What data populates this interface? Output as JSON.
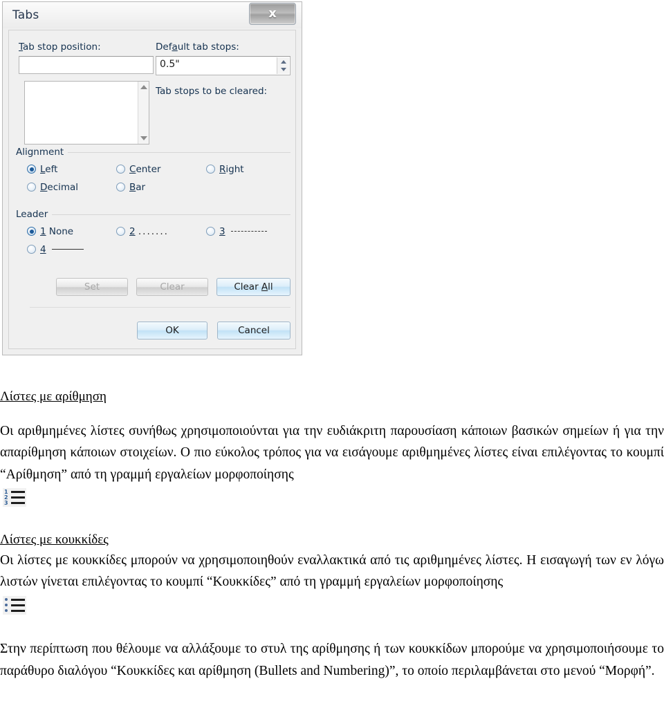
{
  "dialog": {
    "title": "Tabs",
    "close_label": "x",
    "tab_stop_position": {
      "label_pre": "T",
      "label_post": "ab stop position:",
      "value": ""
    },
    "default_tab_stops": {
      "label_pre": "Def",
      "label_mid": "a",
      "label_post": "ult tab stops:",
      "value": "0.5\""
    },
    "tab_stops_to_be_cleared_label": "Tab stops to be cleared:",
    "alignment": {
      "caption": "Alignment",
      "options": [
        {
          "key": "left",
          "accel": "L",
          "rest": "eft",
          "selected": true
        },
        {
          "key": "center",
          "accel": "C",
          "rest": "enter",
          "selected": false
        },
        {
          "key": "right",
          "accel": "R",
          "rest": "ight",
          "selected": false
        },
        {
          "key": "decimal",
          "accel": "D",
          "rest": "ecimal",
          "selected": false
        },
        {
          "key": "bar",
          "accel": "B",
          "rest": "ar",
          "selected": false
        }
      ]
    },
    "leader": {
      "caption": "Leader",
      "options": [
        {
          "key": "none",
          "num": "1",
          "rest": " None",
          "sample": "",
          "selected": true
        },
        {
          "key": "dots",
          "num": "2",
          "rest": " ",
          "sample": ".......",
          "selected": false
        },
        {
          "key": "dashes",
          "num": "3",
          "rest": " ",
          "sample": "-------",
          "selected": false
        },
        {
          "key": "solid",
          "num": "4",
          "rest": " ",
          "sample": "_____",
          "selected": false
        }
      ]
    },
    "buttons": {
      "set": "Set",
      "clear": "Clear",
      "clear_all_pre": "Clear ",
      "clear_all_accel": "A",
      "clear_all_post": "ll",
      "ok": "OK",
      "cancel": "Cancel"
    }
  },
  "document": {
    "heading_numbered": "Λίστες με αρίθμηση",
    "para_numbered": "Οι αριθμημένες λίστες συνήθως χρησιμοποιούνται για την ευδιάκριτη παρουσίαση κάποιων βασικών σημείων ή για την απαρίθμηση κάποιων στοιχείων. Ο πιο εύκολος τρόπος για να εισάγουμε αριθμημένες λίστες είναι επιλέγοντας το κουμπί “Αρίθμηση” από τη γραμμή εργαλείων μορφοποίησης",
    "numbered_icon_marks": [
      "1",
      "2",
      "3"
    ],
    "heading_bulleted": "Λίστες με κουκκίδες",
    "para_bulleted": "Οι λίστες  με κουκκίδες μπορούν να χρησιμοποιηθούν εναλλακτικά από τις αριθμημένες λίστες. Η εισαγωγή των εν λόγω λιστών γίνεται επιλέγοντας το κουμπί “Κουκκίδες” από τη γραμμή εργαλείων μορφοποίησης",
    "para_final": "Στην περίπτωση που θέλουμε να αλλάξουμε το στυλ της αρίθμησης ή των κουκκίδων μπορούμε να χρησιμοποιήσουμε το παράθυρο διαλόγου “Κουκκίδες και αρίθμηση (Bullets and Numbering)”, το οποίο περιλαμβάνεται στο μενού “Μορφή”."
  }
}
